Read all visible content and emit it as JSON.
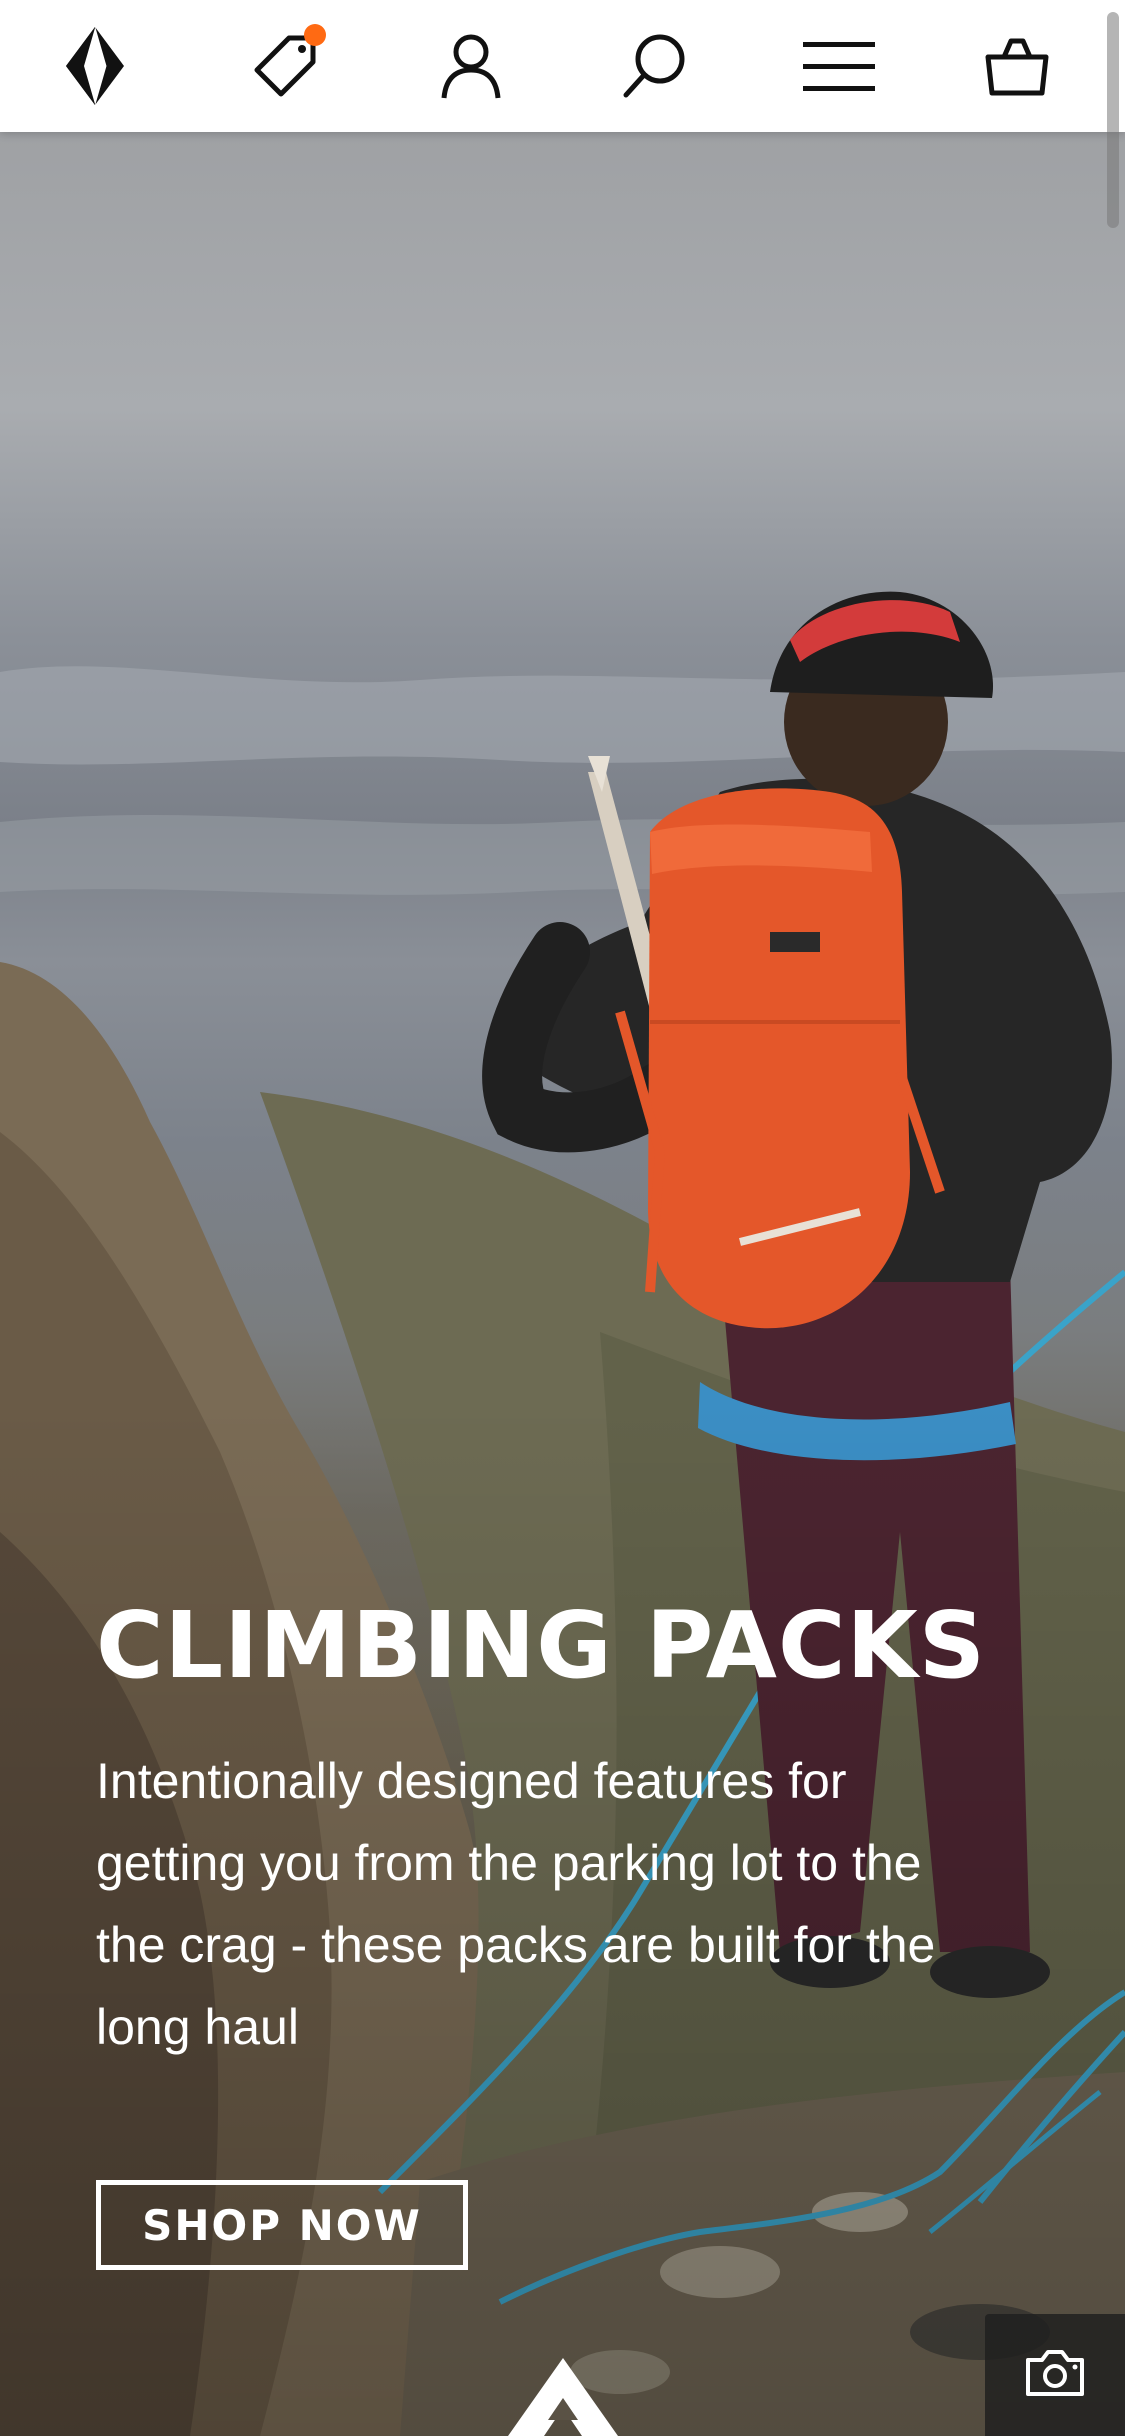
{
  "header": {
    "icons": [
      "black-diamond-logo-icon",
      "tag-icon",
      "user-icon",
      "search-icon",
      "menu-icon",
      "shopping-bag-icon"
    ],
    "badge_color": "#ff6a13"
  },
  "hero": {
    "title": "CLIMBING PACKS",
    "description": "Intentionally designed features for getting you from the parking lot to the the crag - these packs are built for the long haul",
    "cta_label": "SHOP NOW"
  },
  "colors": {
    "header_bg": "#ffffff",
    "icon": "#111111",
    "accent": "#ff6a13",
    "pack": "#e4572a",
    "rope": "#3aa3c9"
  }
}
